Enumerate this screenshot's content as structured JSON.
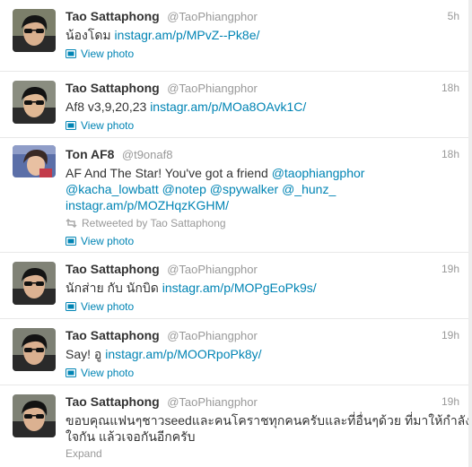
{
  "tweets": [
    {
      "fullname": "Tao Sattaphong",
      "username": "@TaoPhiangphor",
      "time": "5h",
      "text_before": "น้องโดม ",
      "link": "instagr.am/p/MPvZ--Pk8e/",
      "view_photo": "View photo",
      "avatar_colors": {
        "bg": "#7c7f6a",
        "hair": "#151515",
        "skin": "#d9b08f"
      }
    },
    {
      "fullname": "Tao Sattaphong",
      "username": "@TaoPhiangphor",
      "time": "18h",
      "text_before": "Af8 v3,9,20,23 ",
      "link": "instagr.am/p/MOa8OAvk1C/",
      "view_photo": "View photo",
      "avatar_colors": {
        "bg": "#8a8d80",
        "hair": "#121212",
        "skin": "#e0b894"
      }
    },
    {
      "fullname": "Ton AF8",
      "username": "@t9onaf8",
      "time": "18h",
      "line1": "AF And The Star! You've got a friend ",
      "mention1": "@taophiangphor",
      "mention2": "@kacha_lowbatt",
      "mention3": "@notep",
      "mention4": "@spywalker",
      "mention5": "@_hunz_",
      "link": "instagr.am/p/MOZHqzKGHM/",
      "retweeted_by": "Retweeted by Tao Sattaphong",
      "view_photo": "View photo",
      "avatar_colors": {
        "bg": "#5b6fa8",
        "hair": "#3a2a26",
        "skin": "#e8c0a2"
      }
    },
    {
      "fullname": "Tao Sattaphong",
      "username": "@TaoPhiangphor",
      "time": "19h",
      "text_before": "นักส่าย กับ นักบิด ",
      "link": "instagr.am/p/MOPgEoPk9s/",
      "view_photo": "View photo",
      "avatar_colors": {
        "bg": "#808276",
        "hair": "#141414",
        "skin": "#dcb292"
      }
    },
    {
      "fullname": "Tao Sattaphong",
      "username": "@TaoPhiangphor",
      "time": "19h",
      "text_before": "Say! อู ",
      "link": "instagr.am/p/MOORpoPk8y/",
      "view_photo": "View photo",
      "avatar_colors": {
        "bg": "#7d8074",
        "hair": "#131313",
        "skin": "#dab090"
      }
    },
    {
      "fullname": "Tao Sattaphong",
      "username": "@TaoPhiangphor",
      "time": "19h",
      "text_line1": "ขอบคุณแฟนๆชาวseedและคนโคราชทุกคนครับและที่อื่นๆด้วย ที่มาให้กำลัง",
      "text_line2": "ใจกัน แล้วเจอกันอีกครับ",
      "expand": "Expand",
      "avatar_colors": {
        "bg": "#7e8175",
        "hair": "#121212",
        "skin": "#dbb191"
      }
    }
  ]
}
